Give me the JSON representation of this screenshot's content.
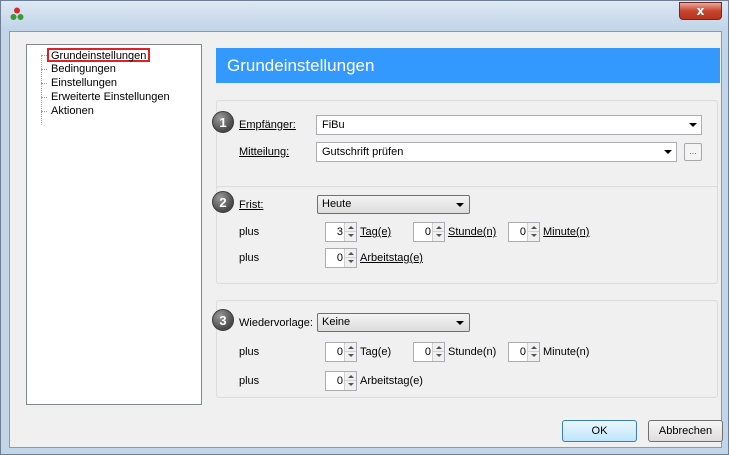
{
  "window": {
    "close_label": "x"
  },
  "tree": {
    "items": [
      "Grundeinstellungen",
      "Bedingungen",
      "Einstellungen",
      "Erweiterte Einstellungen",
      "Aktionen"
    ]
  },
  "header": {
    "title": "Grundeinstellungen"
  },
  "group1": {
    "badge": "1",
    "empfaenger_label": "Empfänger:",
    "empfaenger_value": "FiBu",
    "mitteilung_label": "Mitteilung:",
    "mitteilung_value": "Gutschrift prüfen",
    "ellipsis_label": "..."
  },
  "group2": {
    "badge": "2",
    "frist_label": "Frist:",
    "frist_value": "Heute",
    "plus1": "plus",
    "tag_value": "3",
    "tag_label": "Tag(e)",
    "stunde_value": "0",
    "stunde_label": "Stunde(n)",
    "minute_value": "0",
    "minute_label": "Minute(n)",
    "plus2": "plus",
    "arbeitstag_value": "0",
    "arbeitstag_label": "Arbeitstag(e)"
  },
  "group3": {
    "badge": "3",
    "wiedervorlage_label": "Wiedervorlage:",
    "wiedervorlage_value": "Keine",
    "plus1": "plus",
    "tag_value": "0",
    "tag_label": "Tag(e)",
    "stunde_value": "0",
    "stunde_label": "Stunde(n)",
    "minute_value": "0",
    "minute_label": "Minute(n)",
    "plus2": "plus",
    "arbeitstag_value": "0",
    "arbeitstag_label": "Arbeitstag(e)"
  },
  "buttons": {
    "ok": "OK",
    "cancel": "Abbrechen"
  },
  "colors": {
    "header_bg": "#3399ff",
    "selection_border": "#e31f26"
  }
}
